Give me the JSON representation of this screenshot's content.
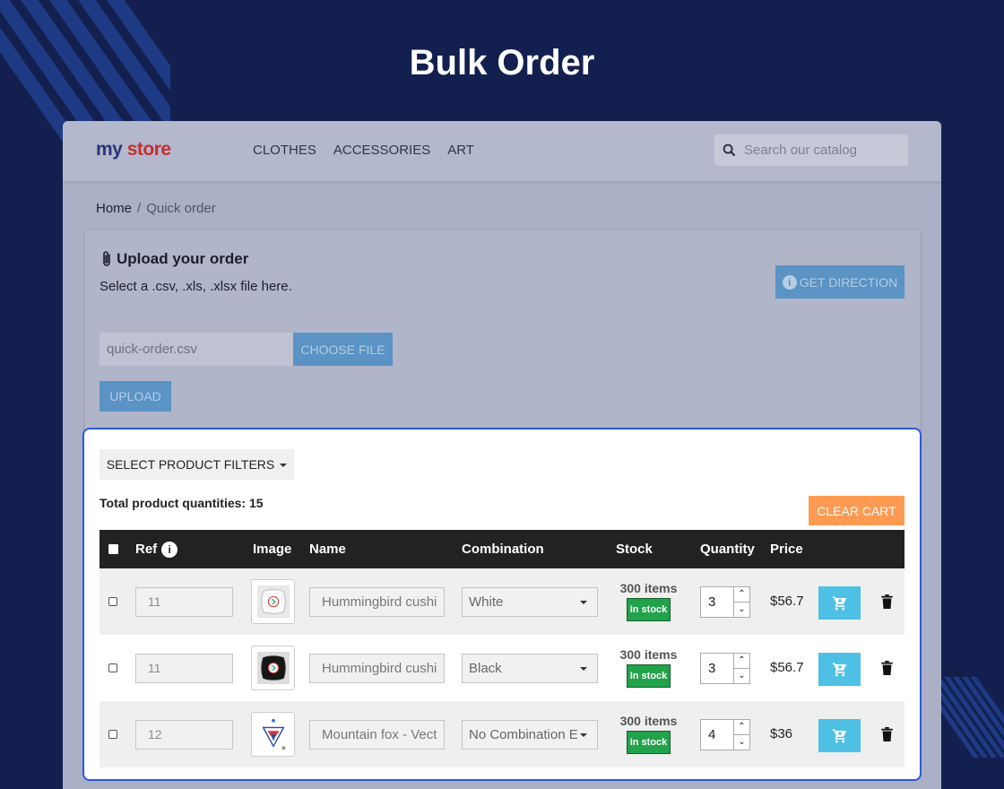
{
  "page_title": "Bulk Order",
  "store": {
    "logo_part1": "my",
    "logo_part2": "store",
    "menu": [
      "CLOTHES",
      "ACCESSORIES",
      "ART"
    ],
    "search_placeholder": "Search our catalog"
  },
  "breadcrumb": {
    "home": "Home",
    "separator": "/",
    "current": "Quick order"
  },
  "upload": {
    "title": "Upload your order",
    "description": "Select a .csv, .xls, .xlsx file here.",
    "get_direction_label": "GET DIRECTION",
    "file_name": "quick-order.csv",
    "choose_file_label": "CHOOSE FILE",
    "upload_label": "UPLOAD"
  },
  "order": {
    "filters_label": "SELECT PRODUCT FILTERS",
    "total_label": "Total product quantities: 15",
    "clear_cart_label": "CLEAR CART",
    "headers": {
      "ref": "Ref",
      "image": "Image",
      "name": "Name",
      "combination": "Combination",
      "stock": "Stock",
      "quantity": "Quantity",
      "price": "Price"
    },
    "rows": [
      {
        "ref": "11",
        "name": "Hummingbird cushi",
        "combination": "White",
        "stock_count": "300 items",
        "stock_status": "In stock",
        "quantity": "3",
        "price": "$56.7"
      },
      {
        "ref": "11",
        "name": "Hummingbird cushi",
        "combination": "Black",
        "stock_count": "300 items",
        "stock_status": "In stock",
        "quantity": "3",
        "price": "$56.7"
      },
      {
        "ref": "12",
        "name": "Mountain fox - Vect",
        "combination": "No Combination Exist",
        "stock_count": "300 items",
        "stock_status": "In stock",
        "quantity": "4",
        "price": "$36"
      }
    ]
  },
  "colors": {
    "background": "#13204f",
    "accent_blue": "#4ec0e4",
    "clear_cart": "#ff9a52",
    "in_stock": "#22a24a",
    "highlight_border": "#2b59e0"
  }
}
